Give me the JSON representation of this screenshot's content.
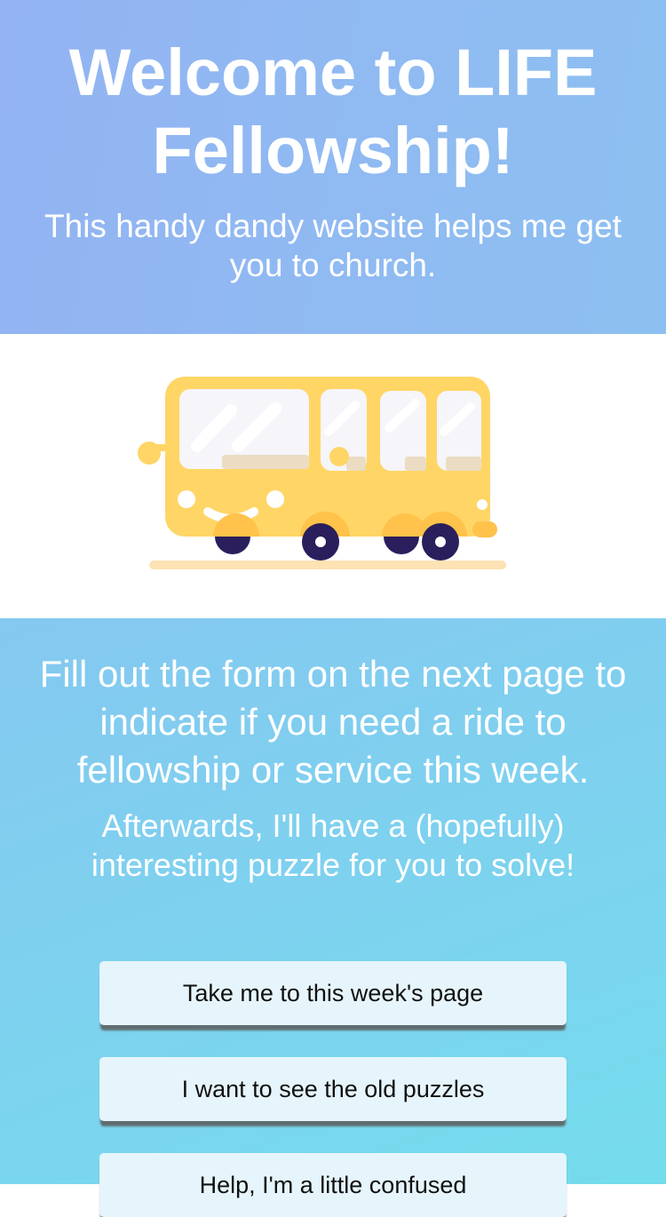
{
  "header": {
    "title": "Welcome to LIFE Fellowship!",
    "subtitle": "This handy dandy website helps me get you to church."
  },
  "hero": {
    "illustration": "bus-illustration",
    "colors": {
      "bus_body": "#ffd566",
      "wheels": "#2a1f5c",
      "ground": "#fde2b3"
    }
  },
  "main": {
    "heading": "Fill out the form on the next page to indicate if you need a ride to fellowship or service this week.",
    "subtext": "Afterwards, I'll have a (hopefully) interesting puzzle for you to solve!"
  },
  "buttons": [
    {
      "label": "Take me to this week's page"
    },
    {
      "label": "I want to see the old puzzles"
    },
    {
      "label": "Help, I'm a little confused"
    }
  ]
}
